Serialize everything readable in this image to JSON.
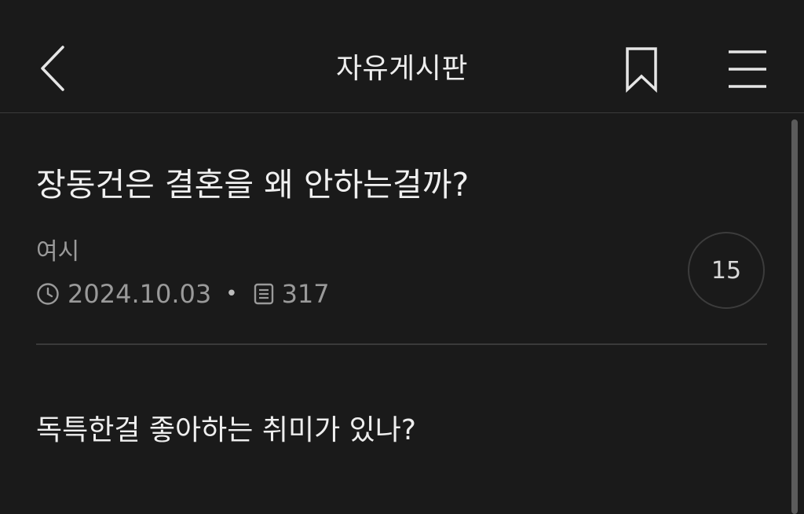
{
  "header": {
    "title": "자유게시판",
    "back_icon": "chevron-left-icon",
    "bookmark_icon": "bookmark-icon",
    "menu_icon": "hamburger-menu-icon"
  },
  "post": {
    "title": "장동건은 결혼을 왜 안하는걸까?",
    "author": "여시",
    "date": "2024.10.03",
    "views": "317",
    "comment_count": "15",
    "body": "독특한걸 좋아하는 취미가 있나?"
  },
  "colors": {
    "background": "#1a1a1a",
    "text": "#ededed",
    "muted": "#9a9a9a",
    "divider": "#3a3a3a"
  }
}
